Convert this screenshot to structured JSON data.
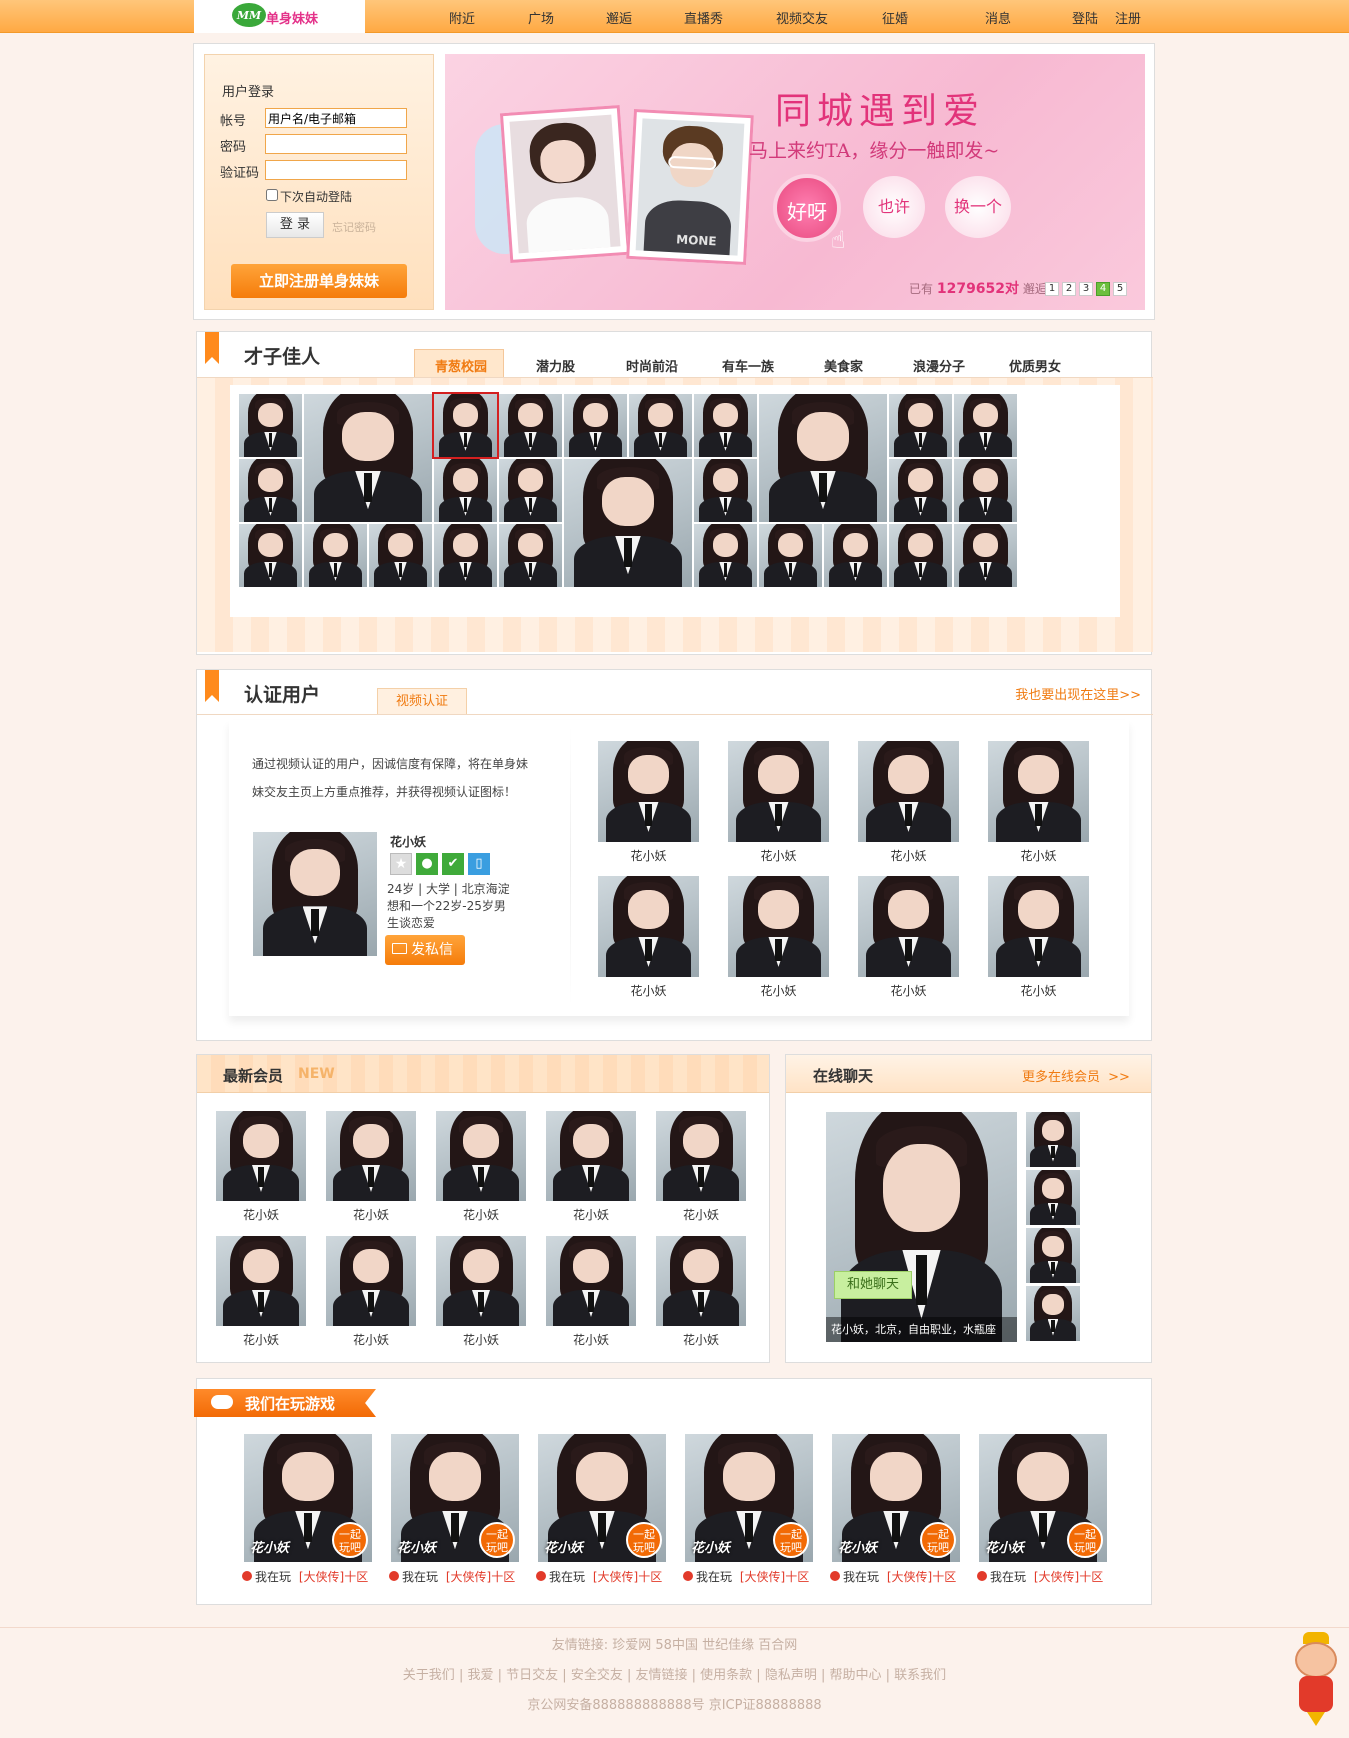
{
  "site": {
    "logo_badge": "MM",
    "logo_text": "单身妹妹"
  },
  "nav": {
    "items": [
      "附近",
      "广场",
      "邂逅",
      "直播秀",
      "视频交友",
      "征婚"
    ],
    "messages": "消息",
    "login": "登陆",
    "register": "注册"
  },
  "login": {
    "title": "用户登录",
    "account_label": "帐号",
    "account_value": "用户名/电子邮箱",
    "password_label": "密码",
    "captcha_label": "验证码",
    "remember_label": "下次自动登陆",
    "login_button": "登 录",
    "forgot": "忘记密码",
    "register_button": "立即注册单身妹妹"
  },
  "banner": {
    "headline": "同城遇到爱",
    "subline": "马上来约TA，缘分一触即发~",
    "btn_yes": "好呀",
    "btn_maybe": "也许",
    "btn_next": "换一个",
    "stat_prefix": "已有",
    "stat_count": "1279652对",
    "stat_suffix": "邂逅",
    "pages": [
      "1",
      "2",
      "3",
      "4",
      "5"
    ],
    "active_page": 3,
    "photo_text": "MONE"
  },
  "talent": {
    "title": "才子佳人",
    "tabs": [
      "青葱校园",
      "潜力股",
      "时尚前沿",
      "有车一族",
      "美食家",
      "浪漫分子",
      "优质男女"
    ],
    "active_tab": 0
  },
  "verified": {
    "title": "认证用户",
    "tab": "视频认证",
    "more": "我也要出现在这里>>",
    "desc": [
      "通过视频认证的用户，因诚信度有保障，将在单身妹",
      "妹交友主页上方重点推荐，并获得视频认证图标！"
    ],
    "featured": {
      "name": "花小妖",
      "info": "24岁 | 大学 | 北京海淀",
      "want": "想和一个22岁-25岁男",
      "want2": "生谈恋爱",
      "msg_button": "发私信"
    },
    "users": [
      "花小妖",
      "花小妖",
      "花小妖",
      "花小妖",
      "花小妖",
      "花小妖",
      "花小妖",
      "花小妖"
    ]
  },
  "newest": {
    "title": "最新会员",
    "badge": "NEW",
    "members": [
      "花小妖",
      "花小妖",
      "花小妖",
      "花小妖",
      "花小妖",
      "花小妖",
      "花小妖",
      "花小妖",
      "花小妖",
      "花小妖"
    ]
  },
  "online": {
    "title": "在线聊天",
    "more": "更多在线会员",
    "more_arrow": ">>",
    "chat_button": "和她聊天",
    "caption": "花小妖，北京，自由职业，水瓶座"
  },
  "games": {
    "title": "我们在玩游戏",
    "players": [
      {
        "name": "花小妖",
        "badge_top": "一起",
        "badge_bottom": "玩吧",
        "playing": "我在玩",
        "game": "[大侠传]十区"
      },
      {
        "name": "花小妖",
        "badge_top": "一起",
        "badge_bottom": "玩吧",
        "playing": "我在玩",
        "game": "[大侠传]十区"
      },
      {
        "name": "花小妖",
        "badge_top": "一起",
        "badge_bottom": "玩吧",
        "playing": "我在玩",
        "game": "[大侠传]十区"
      },
      {
        "name": "花小妖",
        "badge_top": "一起",
        "badge_bottom": "玩吧",
        "playing": "我在玩",
        "game": "[大侠传]十区"
      },
      {
        "name": "花小妖",
        "badge_top": "一起",
        "badge_bottom": "玩吧",
        "playing": "我在玩",
        "game": "[大侠传]十区"
      },
      {
        "name": "花小妖",
        "badge_top": "一起",
        "badge_bottom": "玩吧",
        "playing": "我在玩",
        "game": "[大侠传]十区"
      }
    ]
  },
  "footer": {
    "friends_label": "友情链接:",
    "friends": [
      "珍爱网",
      "58中国",
      "世纪佳缘",
      "百合网"
    ],
    "links": [
      "关于我们",
      "我爱",
      "节日交友",
      "安全交友",
      "友情链接",
      "使用条款",
      "隐私声明",
      "帮助中心",
      "联系我们"
    ],
    "icp": "京公网安备888888888888号 京ICP证88888888"
  },
  "colors": {
    "accent": "#ff8a1c",
    "topbar": "#ffb04f",
    "pink": "#f7b7cf",
    "bg": "#fcf2ec"
  }
}
